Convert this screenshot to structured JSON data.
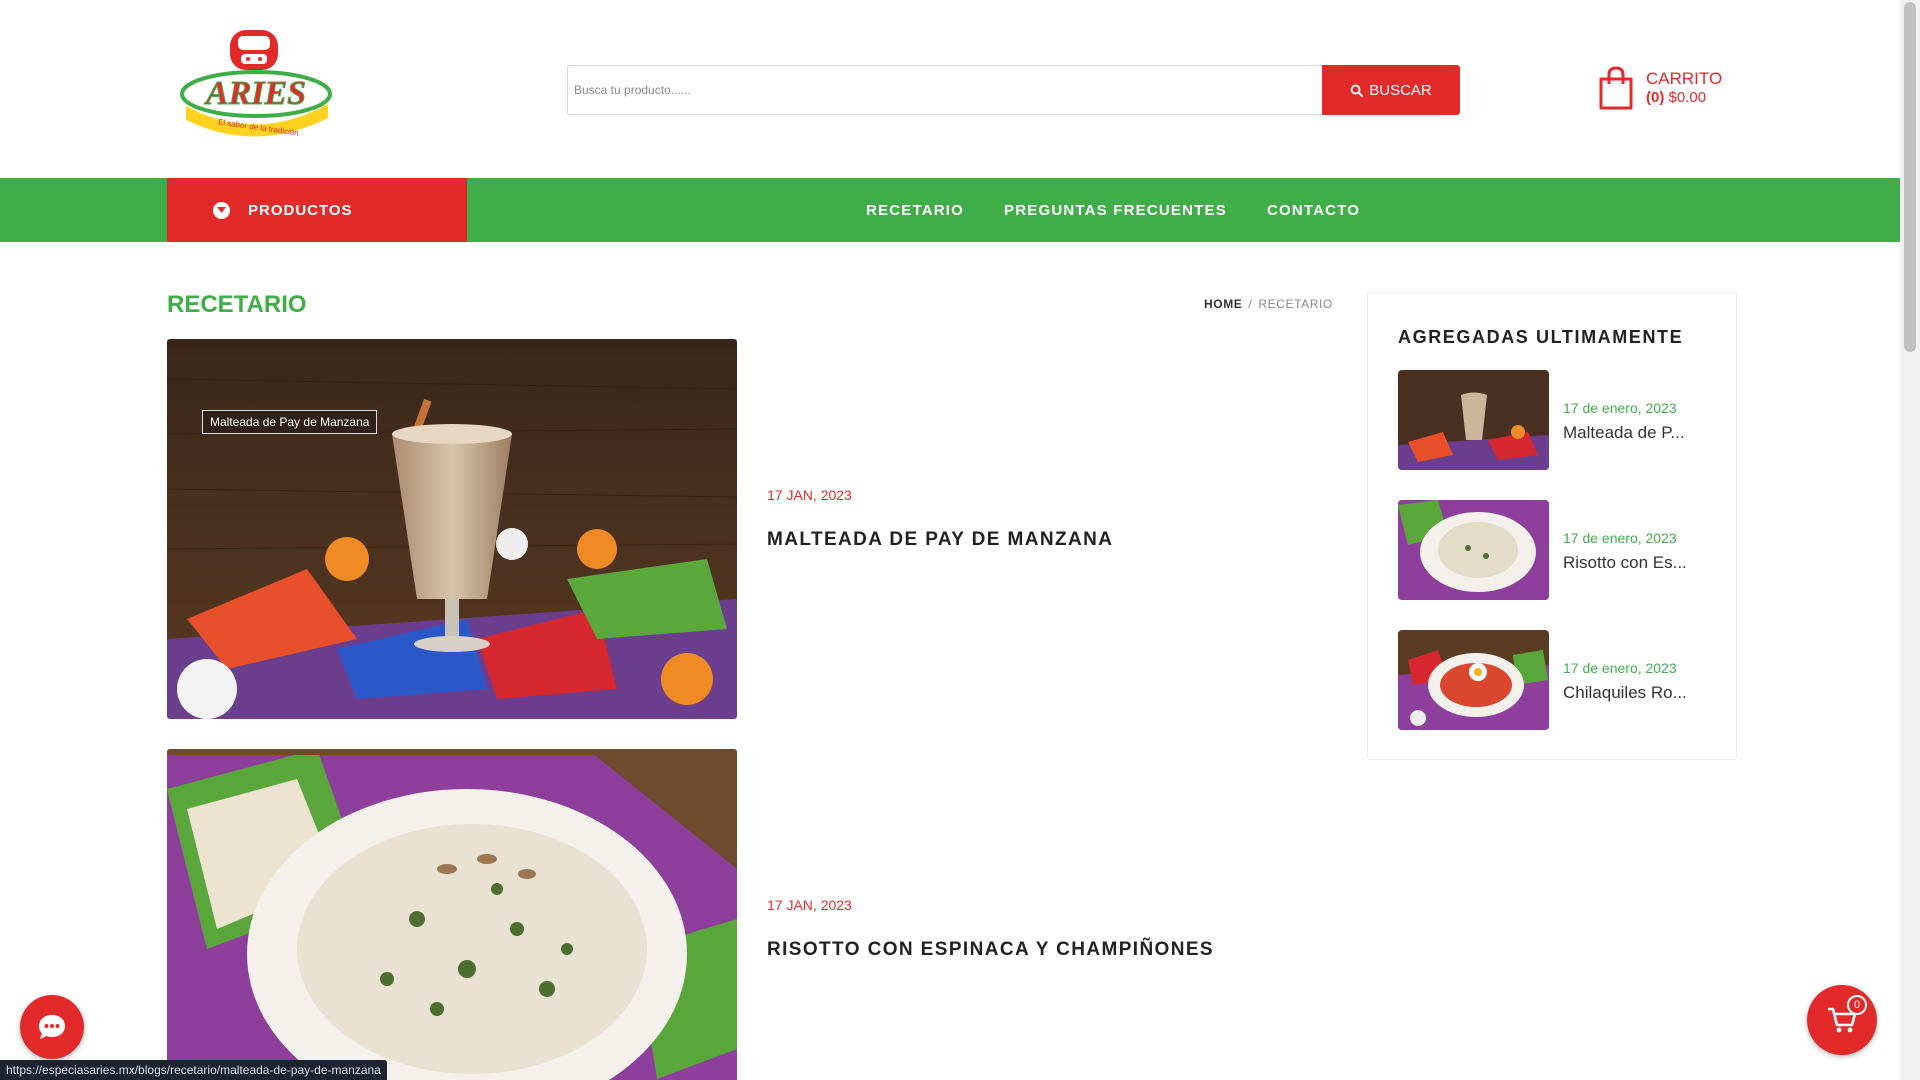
{
  "header": {
    "logo_text": "ARIES",
    "logo_tagline": "El sabor de la tradición",
    "search_placeholder": "Busca tu producto......",
    "search_button": "BUSCAR",
    "cart_title": "CARRITO",
    "cart_count": "(0)",
    "cart_total": "$0.00"
  },
  "nav": {
    "products_label": "PRODUCTOS",
    "links": [
      "RECETARIO",
      "PREGUNTAS FRECUENTES",
      "CONTACTO"
    ]
  },
  "page": {
    "title": "RECETARIO",
    "breadcrumb": {
      "home": "HOME",
      "current": "RECETARIO"
    }
  },
  "posts": [
    {
      "date": "17 JAN, 2023",
      "title": "MALTEADA DE PAY DE MANZANA",
      "image_tag": "Malteada de Pay de Manzana"
    },
    {
      "date": "17 JAN, 2023",
      "title": "RISOTTO CON ESPINACA Y CHAMPIÑONES"
    }
  ],
  "sidebar": {
    "heading": "AGREGADAS ULTIMAMENTE",
    "items": [
      {
        "date": "17 de enero, 2023",
        "title": "Malteada de P..."
      },
      {
        "date": "17 de enero, 2023",
        "title": "Risotto con Es..."
      },
      {
        "date": "17 de enero, 2023",
        "title": "Chilaquiles Ro..."
      }
    ]
  },
  "floating": {
    "cart_badge": "0",
    "status_url": "https://especiasaries.mx/blogs/recetario/malteada-de-pay-de-manzana"
  },
  "colors": {
    "brand_red": "#e32a2a",
    "brand_green": "#3fae49"
  }
}
